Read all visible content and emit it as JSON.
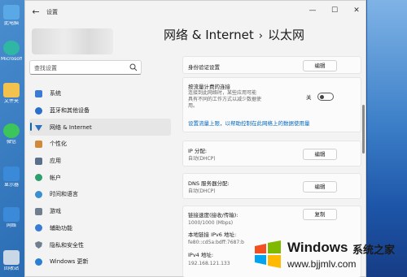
{
  "desktop": {
    "icons": [
      {
        "label": "此电脑",
        "color": "#5aa9e6"
      },
      {
        "label": "Microsoft Edge",
        "color": "#2fb6a5"
      },
      {
        "label": "文件夹",
        "color": "#f2c14e"
      },
      {
        "label": "微信",
        "color": "#3cc55a"
      },
      {
        "label": "显示器",
        "color": "#3b8ad9"
      },
      {
        "label": "网络",
        "color": "#3b8ad9"
      },
      {
        "label": "回收站",
        "color": "#c9d7e6"
      }
    ]
  },
  "window": {
    "title": "设置",
    "controls": {
      "minimize": "—",
      "maximize": "☐",
      "close": "✕"
    }
  },
  "search": {
    "placeholder": "查找设置"
  },
  "nav": {
    "items": [
      {
        "label": "系统",
        "icon": "system-icon",
        "color": "#3a7bd5"
      },
      {
        "label": "蓝牙和其他设备",
        "icon": "bluetooth-icon",
        "color": "#2a6fc9"
      },
      {
        "label": "网络 & Internet",
        "icon": "wifi-icon",
        "color": "#2f6fc0",
        "active": true
      },
      {
        "label": "个性化",
        "icon": "brush-icon",
        "color": "#d08a3a"
      },
      {
        "label": "应用",
        "icon": "apps-icon",
        "color": "#5a6f8a"
      },
      {
        "label": "帐户",
        "icon": "account-icon",
        "color": "#2f9e6f"
      },
      {
        "label": "时间和语言",
        "icon": "globe-time-icon",
        "color": "#3a8fd0"
      },
      {
        "label": "游戏",
        "icon": "gamepad-icon",
        "color": "#6f7f8f"
      },
      {
        "label": "辅助功能",
        "icon": "accessibility-icon",
        "color": "#3a7bd5"
      },
      {
        "label": "隐私和安全性",
        "icon": "shield-icon",
        "color": "#6f7f8f"
      },
      {
        "label": "Windows 更新",
        "icon": "update-icon",
        "color": "#2a7fd0"
      }
    ]
  },
  "breadcrumb": {
    "parent": "网络 & Internet",
    "separator": "›",
    "current": "以太网"
  },
  "content": {
    "auth": {
      "label": "身份验证设置",
      "button": "编辑"
    },
    "metered": {
      "label": "按流量计费的连接",
      "desc1": "连接到此网络时，某些应用可能",
      "desc2": "具有不同的工作方式以减少数据使",
      "desc3": "用。",
      "toggle_text": "关",
      "toggle_on": false,
      "link": "设置流量上限，以帮助控制在此网络上的数据使用量"
    },
    "ip": {
      "label": "IP 分配:",
      "value": "自动(DHCP)",
      "button": "编辑"
    },
    "dns": {
      "label": "DNS 服务器分配:",
      "value": "自动(DHCP)",
      "button": "编辑"
    },
    "link_speed": {
      "label": "链接速度(接收/传输):",
      "value": "1000/1000 (Mbps)",
      "button": "复制"
    },
    "ipv6": {
      "label": "本地链接 IPv6 地址:",
      "value": "fe80::cd5a:bdff:7687:b"
    },
    "ipv4": {
      "label": "IPv4 地址:",
      "value": "192.168.121.133"
    }
  },
  "watermark": {
    "brand": "Windows",
    "brand_cn": "系统之家",
    "url": "www.bjjmlv.com"
  }
}
